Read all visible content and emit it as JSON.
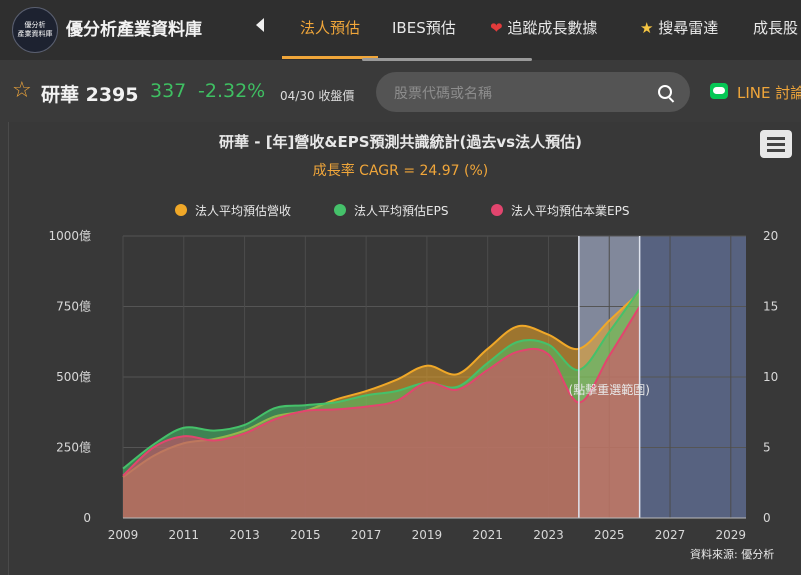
{
  "app": {
    "logo_lines": [
      "優分析",
      "產業資料庫"
    ],
    "brand": "優分析產業資料庫"
  },
  "nav": {
    "tabs": [
      {
        "label": "法人預估",
        "active": true
      },
      {
        "label": "IBES預估",
        "active": false
      },
      {
        "label": "追蹤成長數據",
        "active": false,
        "icon": "heart-icon"
      },
      {
        "label": "搜尋雷達",
        "active": false,
        "icon": "star-icon"
      },
      {
        "label": "成長股",
        "active": false
      }
    ]
  },
  "stock": {
    "name": "研華 2395",
    "price": "337",
    "change": "-2.32%",
    "date_note": "04/30 收盤價",
    "price_color": "#3fbf62"
  },
  "search": {
    "placeholder": "股票代碼或名稱"
  },
  "line_link": {
    "label": "LINE 討論"
  },
  "chart_data": {
    "type": "area",
    "title": "研華 - [年]營收&EPS預測共識統計(過去vs法人預估)",
    "subtitle": "成長率 CAGR = 24.97 (%)",
    "x": [
      2009,
      2010,
      2011,
      2012,
      2013,
      2014,
      2015,
      2016,
      2017,
      2018,
      2019,
      2020,
      2021,
      2022,
      2023,
      2024,
      2025,
      2026
    ],
    "x_ticks": [
      "2009",
      "2011",
      "2013",
      "2015",
      "2017",
      "2019",
      "2021",
      "2023",
      "2025",
      "2027",
      "2029"
    ],
    "xlim": [
      2009,
      2029.5
    ],
    "y_left": {
      "ticks": [
        "0",
        "250億",
        "500億",
        "750億",
        "1000億"
      ],
      "lim": [
        0,
        1000
      ]
    },
    "y_right": {
      "ticks": [
        "0",
        "5",
        "10",
        "15",
        "20"
      ],
      "lim": [
        0,
        20
      ]
    },
    "series": [
      {
        "name": "法人平均預估營收",
        "axis": "left",
        "color": "#f0a828",
        "values": [
          145,
          220,
          265,
          280,
          310,
          360,
          380,
          420,
          450,
          490,
          540,
          510,
          600,
          680,
          650,
          600,
          700,
          800
        ]
      },
      {
        "name": "法人平均預估EPS",
        "axis": "right",
        "color": "#45c16a",
        "values": [
          3.5,
          5.2,
          6.4,
          6.2,
          6.6,
          7.8,
          8.0,
          8.2,
          8.7,
          9.0,
          9.6,
          9.3,
          11.0,
          12.5,
          12.3,
          10.5,
          13.2,
          16.2
        ]
      },
      {
        "name": "法人平均預估本業EPS",
        "axis": "right",
        "color": "#e2456e",
        "values": [
          3.0,
          5.0,
          5.8,
          5.5,
          6.0,
          7.0,
          7.6,
          7.7,
          7.9,
          8.3,
          9.6,
          9.1,
          10.5,
          11.8,
          11.6,
          8.2,
          11.5,
          15.0
        ]
      }
    ],
    "bands": [
      {
        "from": 2024,
        "to": 2026,
        "color": "#9aa3bc"
      },
      {
        "from": 2026,
        "to": 2029.5,
        "color": "#5d6a8d"
      }
    ],
    "overlay_text": "(點擊重選範圍)",
    "grid": true,
    "legend_position": "top"
  },
  "footer": {
    "source": "資料來源: 優分析"
  }
}
